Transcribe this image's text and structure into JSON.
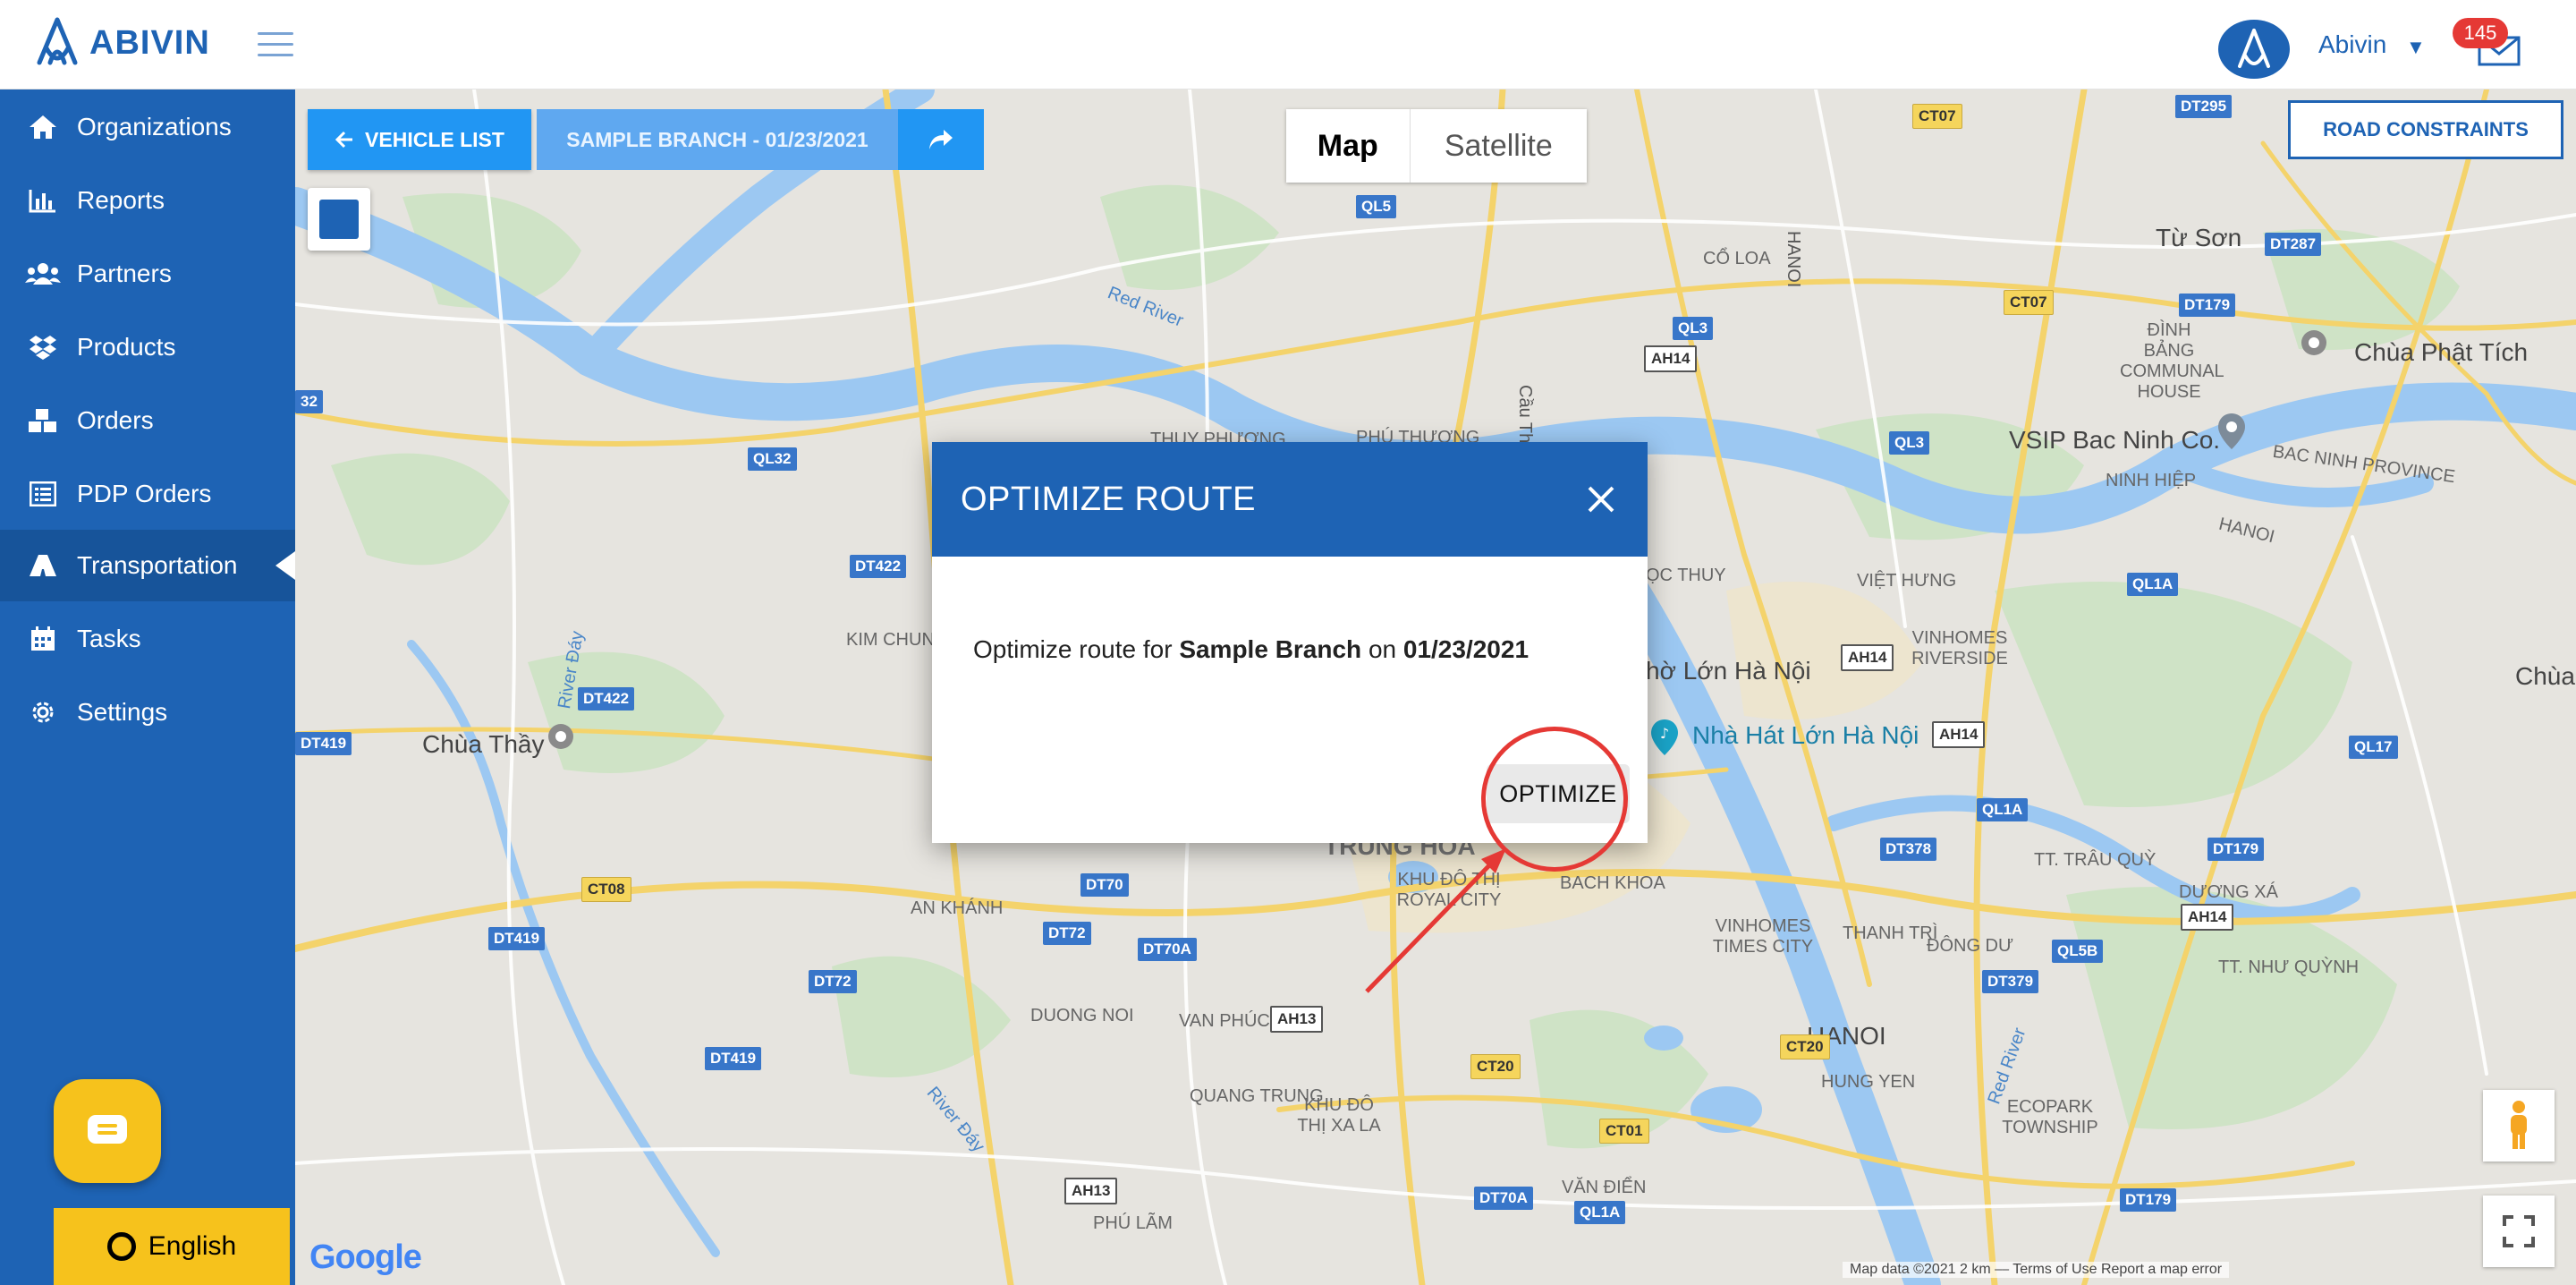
{
  "header": {
    "brand": "ABIVIN",
    "user_name": "Abivin",
    "notification_count": "145"
  },
  "sidebar": {
    "items": [
      {
        "label": "Organizations",
        "icon": "home-icon"
      },
      {
        "label": "Reports",
        "icon": "bar-chart-icon"
      },
      {
        "label": "Partners",
        "icon": "users-icon"
      },
      {
        "label": "Products",
        "icon": "dropbox-icon"
      },
      {
        "label": "Orders",
        "icon": "cubes-icon"
      },
      {
        "label": "PDP Orders",
        "icon": "list-icon"
      },
      {
        "label": "Transportation",
        "icon": "road-icon"
      },
      {
        "label": "Tasks",
        "icon": "calendar-icon"
      },
      {
        "label": "Settings",
        "icon": "gear-icon"
      }
    ],
    "active_index": 6,
    "language": "English"
  },
  "map_toolbar": {
    "vehicle_list": "VEHICLE LIST",
    "branch_date": "SAMPLE BRANCH - 01/23/2021",
    "map_label": "Map",
    "satellite_label": "Satellite",
    "road_constraints": "ROAD CONSTRAINTS"
  },
  "map": {
    "places": {
      "tu_son": "Từ Sơn",
      "chua_phat_tich": "Chùa Phật Tích",
      "vsip": "VSIP Bac Ninh Co.",
      "bac_ninh_province": "BAC NINH PROVINCE",
      "hanoi_ne": "HANOI",
      "chua_thay": "Chùa Thầy",
      "nha_hat": "Nhà Hát Lớn Hà Nội",
      "cho_lon": "hờ Lớn Hà Nội",
      "trung_hoa": "TRUNG HOA",
      "hanoi_s": "HANOI",
      "hung_yen": "HUNG YEN",
      "chua_d": "Chùa D",
      "red_river": "Red River",
      "cau_thang_long": "Cầu Thăng Long",
      "co_loa": "CỔ LOA",
      "kim_chung": "KIM CHUNG",
      "viet_hung": "VIỆT HƯNG",
      "vinhomes_riverside": "VINHOMES RIVERSIDE",
      "vinhomes_times": "VINHOMES TIMES CITY",
      "an_khanh": "AN KHÁNH",
      "duong_noi": "DUONG NOI",
      "van_phuc": "VAN PHÚC",
      "quang_trung": "QUANG TRUNG",
      "phu_lam": "PHÚ LÃM",
      "bach_khoa": "BACH KHOA",
      "thanh_tri": "THANH TRÌ",
      "dong_du": "ĐÔNG DƯ",
      "tt_trau_quy": "TT. TRÂU QUỲ",
      "duong_xa": "DƯƠNG XÁ",
      "tt_nhu_quynh": "TT. NHƯ QUỲNH",
      "van_dien": "VĂN ĐIỂN",
      "ninh_hiep": "NINH HIỆP",
      "dinh_bang": "ĐÌNH BẢNG COMMUNAL HOUSE",
      "thuy_phuong": "THUY PHƯƠNG",
      "phu_thuong": "PHÚ THƯỢNG",
      "khu_do_thi_royal": "KHU ĐÔ THỊ ROYAL CITY",
      "khu_do_thi_xa_la": "KHU ĐÔ THỊ XA LA",
      "ecopark": "ECOPARK TOWNSHIP",
      "oc_thuy": "ỌC THUY",
      "river_day": "River Đáy",
      "river_day2": "River Đáy",
      "red_river2": "Red River",
      "hanoi_ne2": "HANOI"
    },
    "shields": [
      "CT07",
      "DT295",
      "DT287",
      "CT07",
      "DT179",
      "QL3",
      "AH14",
      "QL5",
      "QL32",
      "DT422",
      "DT422",
      "QL3",
      "QL1A",
      "AH14",
      "AH14",
      "DT419",
      "CT08",
      "DT419",
      "DT72",
      "DT70",
      "DT72",
      "DT70A",
      "AH13",
      "DT378",
      "QL1A",
      "DT379",
      "QL5B",
      "AH14",
      "DT179",
      "CT20",
      "CT01",
      "CT20",
      "DT70A",
      "QL1A",
      "DT179",
      "AH13",
      "DT419",
      "QL17",
      "32"
    ],
    "footer": "Map data ©2021   2 km ⎯⎯   Terms of Use   Report a map error",
    "google": "Google"
  },
  "modal": {
    "title": "OPTIMIZE ROUTE",
    "text_prefix": "Optimize route for ",
    "branch": "Sample Branch",
    "text_mid": " on ",
    "date": "01/23/2021",
    "optimize_button": "OPTIMIZE"
  },
  "colors": {
    "primary": "#1e63b4",
    "accent": "#2196f3",
    "highlight": "#e53935",
    "chat": "#f6c21c"
  }
}
